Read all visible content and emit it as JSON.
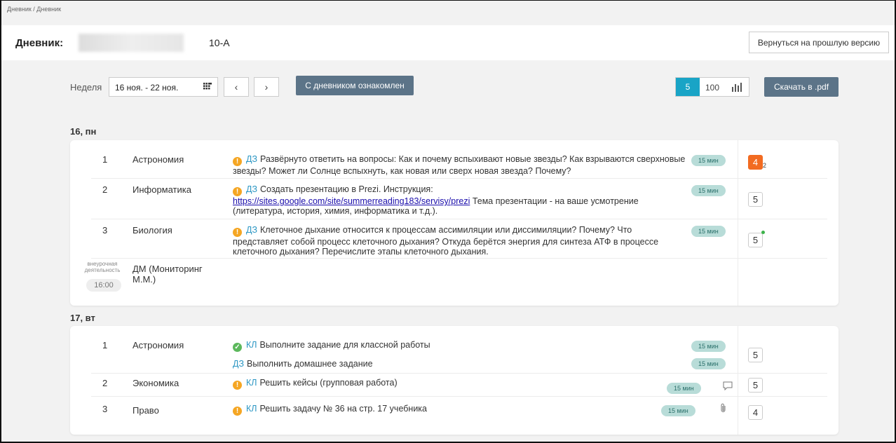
{
  "breadcrumb": "Дневник / Дневник",
  "header": {
    "label": "Дневник:",
    "class_name": "10-А",
    "back_button": "Вернуться на прошлую версию"
  },
  "toolbar": {
    "week_label": "Неделя",
    "week_range": "16 ноя. - 22 ноя.",
    "prev": "‹",
    "next": "›",
    "ack_button": "С дневником ознакомлен",
    "scale_5": "5",
    "scale_100": "100",
    "pdf_button": "Скачать в .pdf"
  },
  "days": [
    {
      "title": "16, пн",
      "lessons": [
        {
          "num": "1",
          "subject": "Астрономия",
          "icon": "warning-icon",
          "tag": "ДЗ",
          "text": "Развёрнуто ответить на вопросы: Как и почему вспыхивают новые звезды? Как взрываются сверхновые звезды? Может ли Солнце вспыхнуть, как новая или сверх новая звезда? Почему?",
          "time": "15 мин",
          "grade": "4",
          "grade_sub": "2"
        },
        {
          "num": "2",
          "subject": "Информатика",
          "icon": "warning-icon",
          "tag": "ДЗ",
          "text_a": "Создать презентацию в Prezi. Инструкция:",
          "link": "https://sites.google.com/site/summerreading183/servisy/prezi",
          "text_b": " Тема презентации - на ваше усмотрение (литература, история, химия, информатика и т.д.).",
          "time": "15 мин",
          "grade": "5"
        },
        {
          "num": "3",
          "subject": "Биология",
          "icon": "warning-icon",
          "tag": "ДЗ",
          "text": "Клеточное дыхание относится к процессам ассимиляции или диссимиляции? Почему? Что представляет собой процесс клеточного дыхания? Откуда берётся энергия для синтеза АТФ в процессе клеточного дыхания? Перечислите этапы клеточного дыхания.",
          "time": "15 мин",
          "grade": "5"
        }
      ],
      "extra": {
        "label": "внеурочная деятельность",
        "subject": "ДМ (Мониторинг М.М.)",
        "time": "16:00"
      }
    },
    {
      "title": "17, вт",
      "lessons": [
        {
          "num": "1",
          "subject": "Астрономия",
          "icon": "check-icon",
          "tag": "КЛ",
          "text": "Выполните задание для классной работы",
          "time": "15 мин",
          "tag2": "ДЗ",
          "text2": "Выполнить домашнее задание",
          "time2": "15 мин",
          "grade": "5"
        },
        {
          "num": "2",
          "subject": "Экономика",
          "icon": "warning-icon",
          "tag": "КЛ",
          "text": "Решить кейсы (групповая работа)",
          "time": "15 мин",
          "grade": "5"
        },
        {
          "num": "3",
          "subject": "Право",
          "icon": "warning-icon",
          "tag": "КЛ",
          "text": "Решить задачу № 36 на стр. 17 учебника",
          "time": "15 мин",
          "grade": "4"
        }
      ]
    }
  ]
}
